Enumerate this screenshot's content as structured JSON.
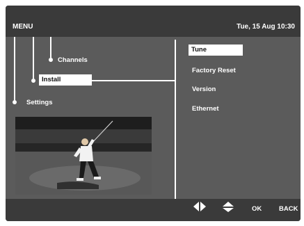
{
  "topbar": {
    "title": "MENU",
    "datetime": "Tue, 15 Aug 10:30"
  },
  "menu": {
    "left": {
      "channels": "Channels",
      "install": "Install",
      "settings": "Settings"
    },
    "right": {
      "items": [
        "Tune",
        "Factory Reset",
        "Version",
        "Ethernet"
      ],
      "selected_index": 0
    }
  },
  "footer": {
    "icons": [
      "left-right-arrows-icon",
      "up-down-arrows-icon"
    ],
    "ok": "OK",
    "back": "BACK"
  }
}
